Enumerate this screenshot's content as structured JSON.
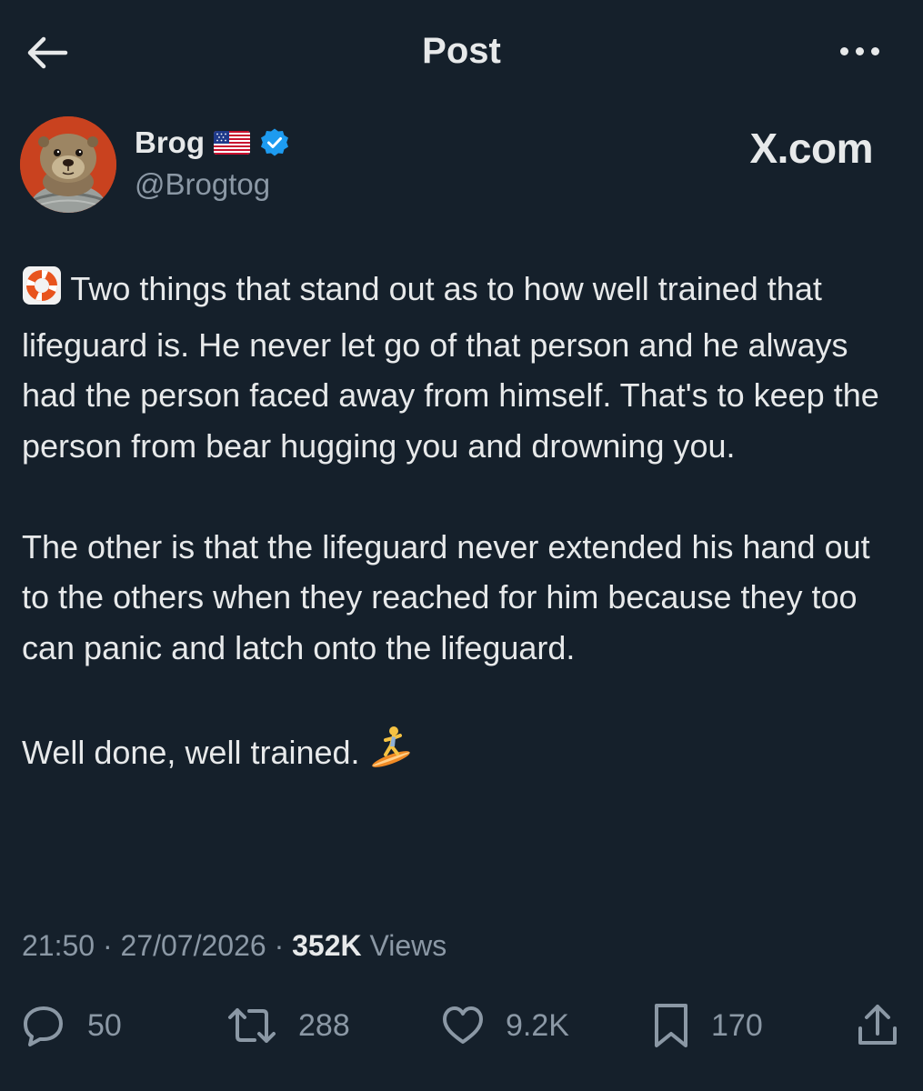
{
  "header": {
    "title": "Post"
  },
  "post": {
    "author": {
      "display_name": "Brog",
      "handle": "@Brogtog",
      "flag_icon": "us-flag-icon",
      "verified_icon": "verified-badge-icon"
    },
    "watermark": "X.com",
    "paragraphs": [
      "Two things that stand out as to how well trained that lifeguard is.  He never let go of that person and he always had the person faced away from himself. That's to keep the person from bear hugging you and drowning you.",
      "The other is that the lifeguard never extended his hand out to the others when they reached for him because they too can panic and latch onto the lifeguard.",
      "Well done, well trained."
    ],
    "leading_emoji": "ring-buoy-icon",
    "trailing_emoji": "surfer-icon",
    "time": "21:50",
    "separator": "·",
    "date": "27/07/2026",
    "views_count": "352K",
    "views_label": "Views"
  },
  "actions": {
    "replies": "50",
    "reposts": "288",
    "likes": "9.2K",
    "bookmarks": "170"
  },
  "colors": {
    "background": "#15202b",
    "text": "#e7e9ea",
    "secondary": "#8b98a5",
    "verified": "#1d9bf0"
  }
}
